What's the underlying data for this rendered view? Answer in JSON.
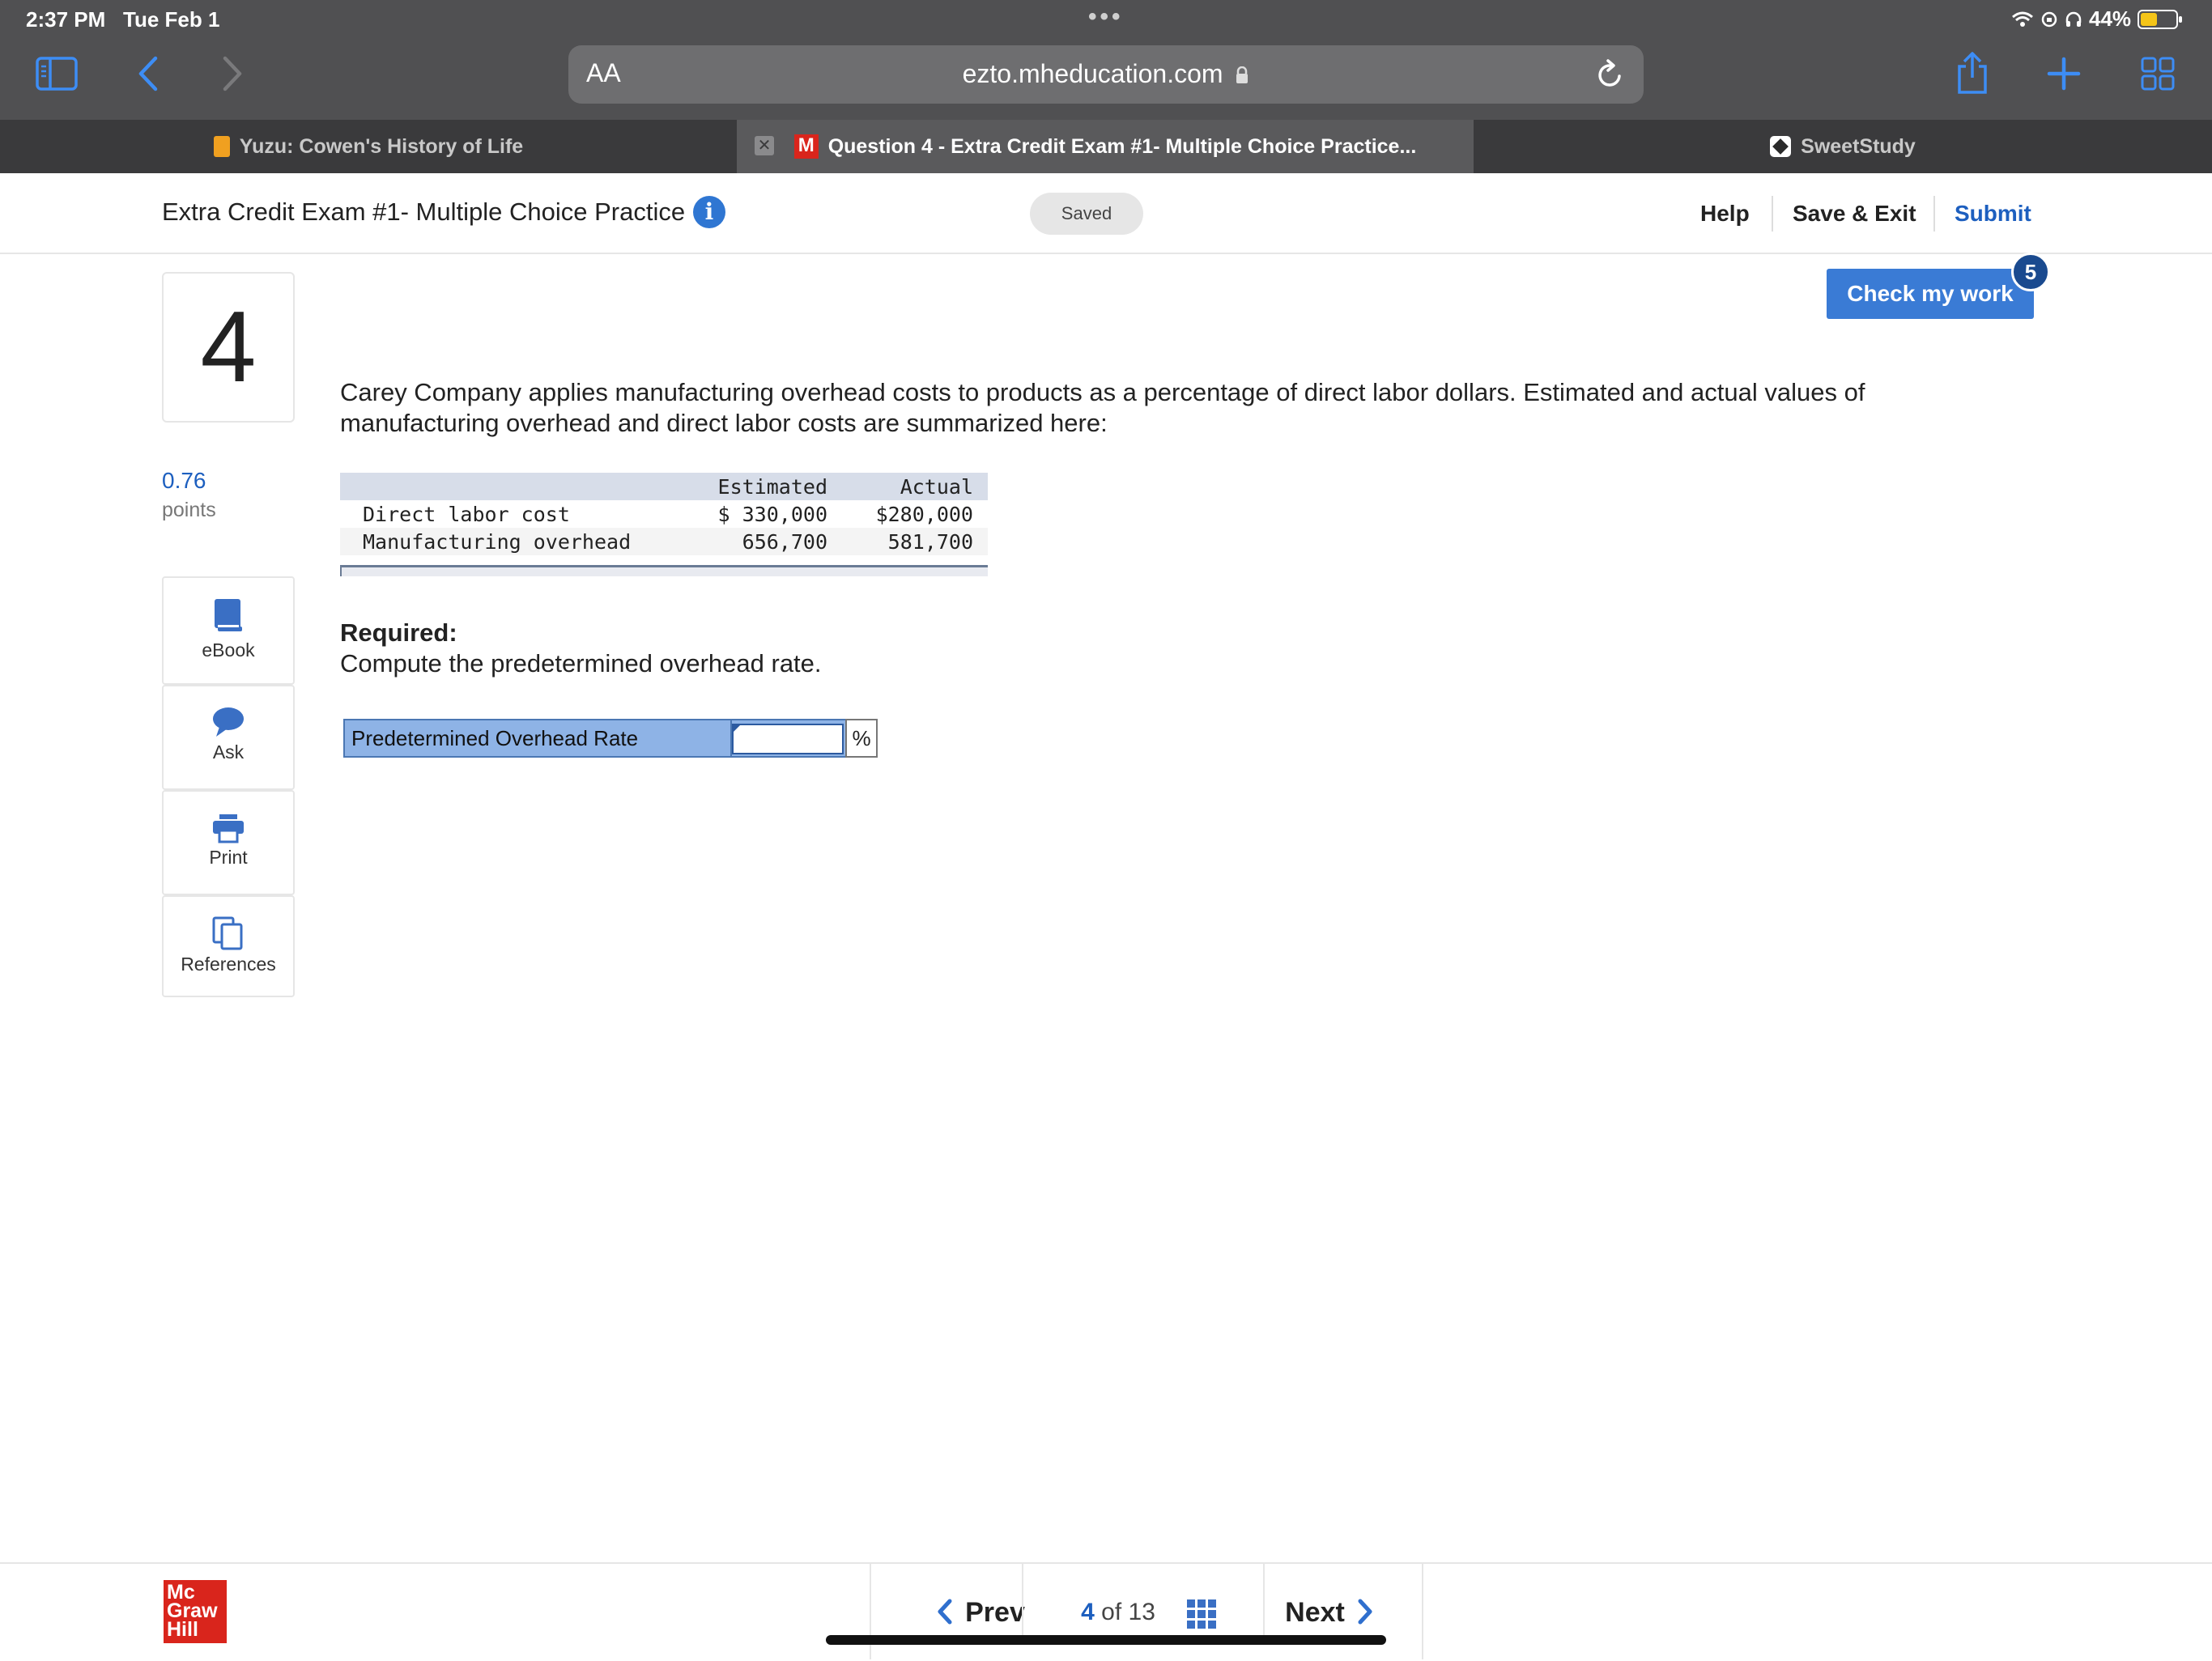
{
  "status_bar": {
    "time": "2:37 PM",
    "date": "Tue Feb 1",
    "battery": "44%"
  },
  "browser": {
    "text_size_label": "AA",
    "url": "ezto.mheducation.com",
    "tabs": [
      {
        "label": "Yuzu: Cowen's History of Life"
      },
      {
        "label": "Question 4 - Extra Credit Exam #1- Multiple Choice Practice..."
      },
      {
        "label": "SweetStudy"
      }
    ]
  },
  "header": {
    "title": "Extra Credit Exam #1- Multiple Choice Practice",
    "saved_label": "Saved",
    "help_label": "Help",
    "save_exit_label": "Save & Exit",
    "submit_label": "Submit"
  },
  "check_my_work": {
    "label": "Check my work",
    "badge": "5"
  },
  "question": {
    "number": "4",
    "points_value": "0.76",
    "points_label": "points",
    "text": "Carey Company applies manufacturing overhead costs to products as a percentage of direct labor dollars. Estimated and actual values of manufacturing overhead and direct labor costs are summarized here:",
    "table": {
      "headers": [
        "",
        "Estimated",
        "Actual"
      ],
      "rows": [
        [
          "Direct labor cost",
          "$ 330,000",
          "$280,000"
        ],
        [
          "Manufacturing overhead",
          "656,700",
          "581,700"
        ]
      ]
    },
    "required_label": "Required:",
    "required_text": "Compute the predetermined overhead rate.",
    "answer": {
      "label": "Predetermined Overhead Rate",
      "value": "",
      "unit": "%"
    }
  },
  "tools": [
    {
      "label": "eBook"
    },
    {
      "label": "Ask"
    },
    {
      "label": "Print"
    },
    {
      "label": "References"
    }
  ],
  "footer": {
    "logo_lines": [
      "Mc",
      "Graw",
      "Hill"
    ],
    "prev_label": "Prev",
    "next_label": "Next",
    "current_page": "4",
    "of_label": "of",
    "total_pages": "13"
  },
  "colors": {
    "accent": "#3a7bd5",
    "link": "#1d5fbf",
    "answer_bg": "#8eb3e6",
    "brand_red": "#d9251c"
  }
}
